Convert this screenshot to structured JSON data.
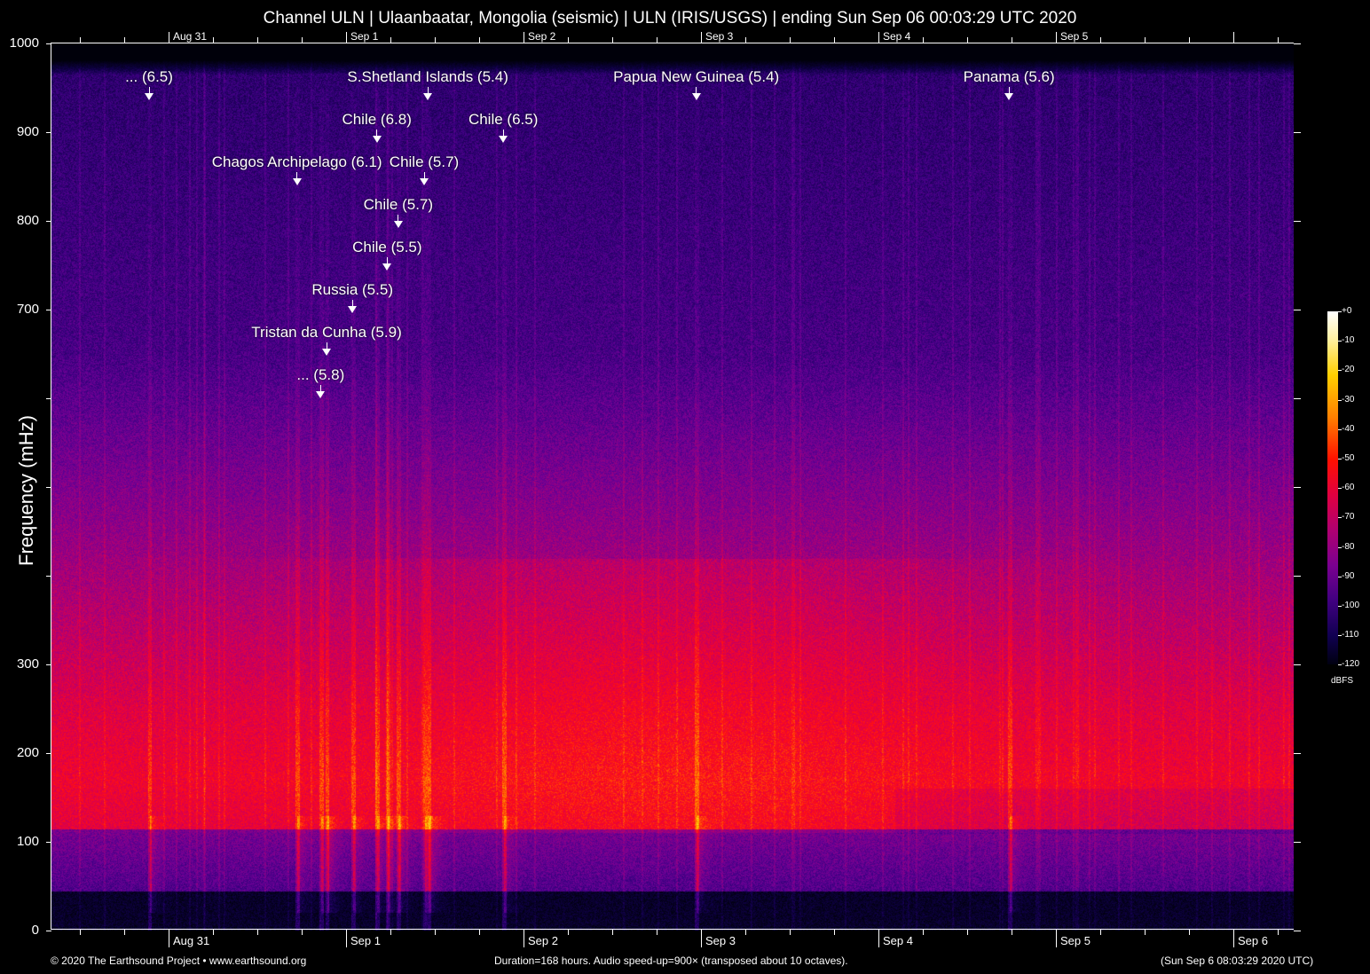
{
  "title": "Channel ULN | Ulaanbaatar, Mongolia (seismic) | ULN (IRIS/USGS) | ending Sun Sep 06 00:03:29 UTC 2020",
  "chart_data": {
    "type": "heatmap",
    "title": "Channel ULN | Ulaanbaatar, Mongolia (seismic) | ULN (IRIS/USGS) | ending Sun Sep 06 00:03:29 UTC 2020",
    "ylabel": "Frequency (mHz)",
    "ylim": [
      0,
      1000
    ],
    "y_ticks": [
      0,
      100,
      200,
      300,
      400,
      500,
      600,
      700,
      800,
      900,
      1000
    ],
    "y_tick_labels": [
      "0",
      "100",
      "200",
      "300",
      "",
      "",
      "",
      "700",
      "800",
      "900",
      "1000"
    ],
    "x_duration_hours": 168,
    "x_day_labels_top": [
      "Aug 31",
      "Sep  1",
      "Sep  2",
      "Sep  3",
      "Sep  4",
      "Sep  5"
    ],
    "x_day_labels_bottom": [
      "Aug 31",
      "Sep  1",
      "Sep  2",
      "Sep  3",
      "Sep  4",
      "Sep  5",
      "Sep  6"
    ],
    "x_day_hours": [
      15.84,
      39.84,
      63.84,
      87.84,
      111.84,
      135.84,
      159.84
    ],
    "events": [
      {
        "label": "... (6.5)",
        "hour": 13.2
      },
      {
        "label": "S.Shetland Islands (5.4)",
        "hour": 50.9
      },
      {
        "label": "Papua New Guinea (5.4)",
        "hour": 87.2
      },
      {
        "label": "Panama (5.6)",
        "hour": 129.5
      },
      {
        "label": "Chile (6.8)",
        "hour": 44.0
      },
      {
        "label": "Chile (6.5)",
        "hour": 61.1
      },
      {
        "label": "Chagos Archipelago (6.1)",
        "hour": 33.2
      },
      {
        "label": "Chile (5.7)",
        "hour": 50.4
      },
      {
        "label": "Chile (5.7)",
        "hour": 46.9
      },
      {
        "label": "Chile (5.5)",
        "hour": 45.4
      },
      {
        "label": "Russia (5.5)",
        "hour": 40.7
      },
      {
        "label": "Tristan da Cunha (5.9)",
        "hour": 37.2
      },
      {
        "label": "... (5.8)",
        "hour": 36.4
      }
    ],
    "colorbar": {
      "label": "dBFS",
      "ticks": [
        "+0",
        "-10",
        "-20",
        "-30",
        "-40",
        "-50",
        "-60",
        "-70",
        "-80",
        "-90",
        "-100",
        "-110",
        "-120"
      ],
      "range": [
        -120,
        0
      ]
    }
  },
  "footer": {
    "left": "© 2020 The Earthsound Project • www.earthsound.org",
    "center": "Duration=168 hours. Audio speed-up=900× (transposed about 10 octaves).",
    "right": "(Sun Sep  6 08:03:29 2020 UTC)"
  },
  "colors": {
    "background": "#000000",
    "text": "#ffffff"
  }
}
